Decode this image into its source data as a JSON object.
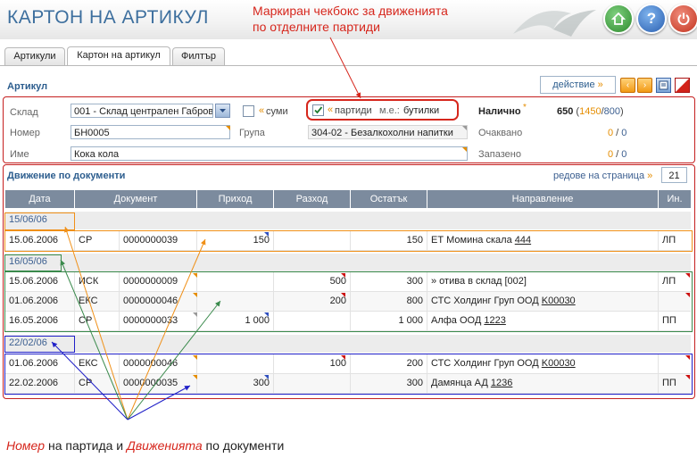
{
  "app": {
    "title": "КАРТОН НА АРТИКУЛ"
  },
  "annotations": {
    "top_note_line1": "Маркиран чекбокс за движенията",
    "top_note_line2": "по отделните партиди",
    "bottom_note_part1": "Номер",
    "bottom_note_part2": " на партида и ",
    "bottom_note_part3": "Движенията",
    "bottom_note_part4": " по документи"
  },
  "tabs": [
    {
      "label": "Артикули"
    },
    {
      "label": "Картон на артикул"
    },
    {
      "label": "Филтър"
    }
  ],
  "article": {
    "section_title": "Артикул",
    "action_label": "действие",
    "action_arrow": "»",
    "warehouse_label": "Склад",
    "warehouse_value": "001 - Склад централен Габрово",
    "sums_label": "суми",
    "lots_label": "партиди",
    "unit_label": "м.е.:",
    "unit_value": "бутилки",
    "number_label": "Номер",
    "number_value": "БН0005",
    "group_label": "Група",
    "group_value": "304-02 - Безалкохолни напитки",
    "name_label": "Име",
    "name_value": "Кока кола",
    "available_label": "Налично",
    "available_total": "650",
    "available_a": "1450",
    "available_b": "800",
    "expected_label": "Очаквано",
    "expected_a": "0",
    "expected_b": "0",
    "reserved_label": "Запазено",
    "reserved_a": "0",
    "reserved_b": "0"
  },
  "movements": {
    "section_title": "Движение по документи",
    "rows_per_page_label": "редове на страница",
    "rows_per_page_value": "21",
    "columns": [
      "Дата",
      "Документ",
      "Приход",
      "Разход",
      "Остатък",
      "Направление",
      "Ин."
    ],
    "groups": [
      {
        "lot": "15/06/06",
        "rows": [
          {
            "date": "15.06.2006",
            "doc_type": "СР",
            "doc_no": "0000000039",
            "income": "150",
            "expense": "",
            "balance": "150",
            "direction": "ЕТ Момина скала",
            "direction_link": "444",
            "ini": "ЛП"
          }
        ]
      },
      {
        "lot": "16/05/06",
        "rows": [
          {
            "date": "15.06.2006",
            "doc_type": "ИСК",
            "doc_no": "0000000009",
            "income": "",
            "expense": "500",
            "balance": "300",
            "direction": "» отива в склад [002]",
            "direction_link": "",
            "ini": "ЛП"
          },
          {
            "date": "01.06.2006",
            "doc_type": "ЕКС",
            "doc_no": "0000000046",
            "income": "",
            "expense": "200",
            "balance": "800",
            "direction": "СТС Холдинг Груп ООД",
            "direction_link": "K00030",
            "ini": ""
          },
          {
            "date": "16.05.2006",
            "doc_type": "СР",
            "doc_no": "0000000033",
            "income": "1 000",
            "expense": "",
            "balance": "1 000",
            "direction": "Алфа ООД",
            "direction_link": "1223",
            "ini": "ПП"
          }
        ]
      },
      {
        "lot": "22/02/06",
        "rows": [
          {
            "date": "01.06.2006",
            "doc_type": "ЕКС",
            "doc_no": "0000000046",
            "income": "",
            "expense": "100",
            "balance": "200",
            "direction": "СТС Холдинг Груп ООД",
            "direction_link": "K00030",
            "ini": ""
          },
          {
            "date": "22.02.2006",
            "doc_type": "СР",
            "doc_no": "0000000035",
            "income": "300",
            "expense": "",
            "balance": "300",
            "direction": "Дамянца АД",
            "direction_link": "1236",
            "ini": "ПП"
          }
        ]
      }
    ]
  },
  "colors": {
    "accent_blue": "#3d6f9e",
    "annotation_red": "#d6261c",
    "lot_orange": "#f09018",
    "lot_green": "#3a8a4c",
    "lot_blue": "#2020c8",
    "header_gray": "#7c8b9e"
  },
  "icons": [
    "home-icon",
    "help-icon",
    "power-icon",
    "chevron-left-icon",
    "chevron-right-icon",
    "print-icon",
    "pdf-icon",
    "checkbox-checked-icon",
    "checkbox-empty-icon",
    "dropdown-icon"
  ]
}
